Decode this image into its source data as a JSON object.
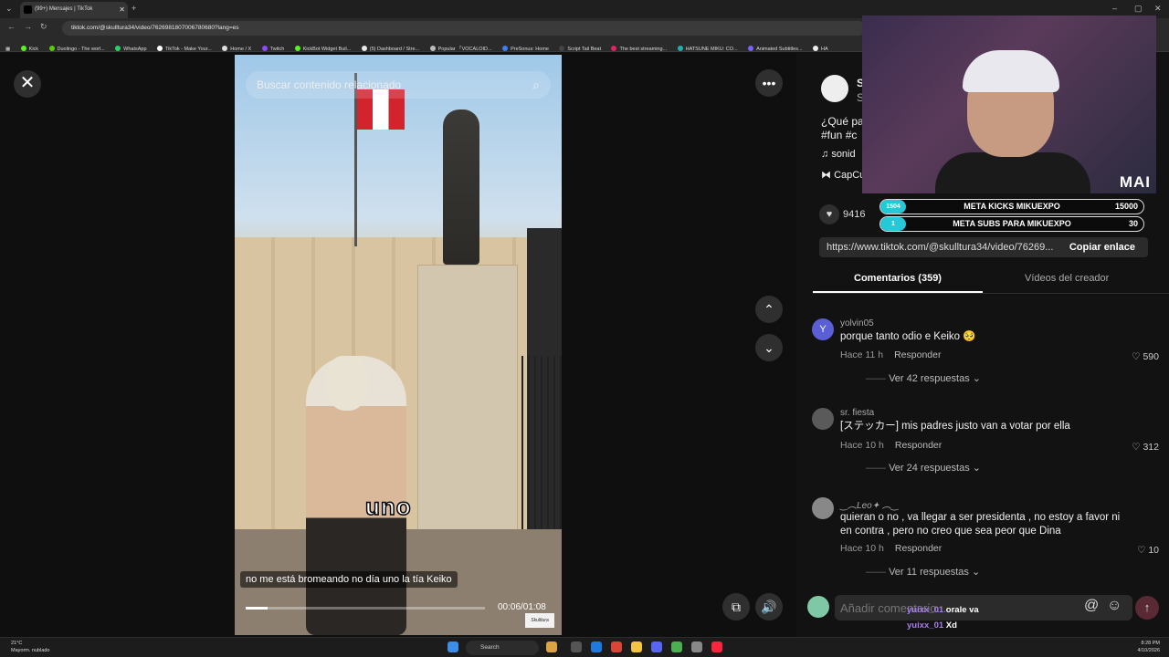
{
  "browser": {
    "tab_title": "(99+) Mensajes | TikTok",
    "url": "tiktok.com/@skulltura34/video/7626981807006780680?lang=es",
    "bookmarks": [
      "Kick",
      "Duolingo - The worl...",
      "WhatsApp",
      "TikTok - Make Your...",
      "Home / X",
      "Twitch",
      "KickBot Widget Buil...",
      "(5) Dashboard / Stre...",
      "Popular 「VOCALOID...",
      "PreSonus: Home",
      "Script Tail Beat",
      "The best streaming...",
      "HATSUNE MIKU: CO...",
      "Animated Subtitles...",
      "HA"
    ]
  },
  "video": {
    "search_placeholder": "Buscar contenido relacionado",
    "caption_word": "uno",
    "subtitle": "no me está bromeando no día uno la tía Keiko",
    "time": "00:06/01:08",
    "progress_fraction": 0.09,
    "watermark": "Skulltura"
  },
  "post": {
    "author_initial": "S",
    "author_line2": "S",
    "description_line1": "¿Qué pa",
    "description_line2": "#fun #c",
    "sound": "sonid",
    "capcut": "CapCu",
    "likes": "9416",
    "link": "https://www.tiktok.com/@skulltura34/video/76269...",
    "copy_label": "Copiar enlace"
  },
  "stream_overlay": {
    "streamer_tag": "MAI",
    "bar1_left": "1504",
    "bar1_label": "META KICKS MIKUEXPO",
    "bar1_right": "15000",
    "bar2_left": "1",
    "bar2_label": "META SUBS PARA MIKUEXPO",
    "bar2_right": "30"
  },
  "tabs": {
    "comments": "Comentarios (359)",
    "creator_videos": "Vídeos del creador"
  },
  "comments": [
    {
      "avatar": "Y",
      "user": "yolvin05",
      "text": "porque tanto odio e Keiko 🥺",
      "time": "Hace 11 h",
      "reply": "Responder",
      "likes": "590",
      "more": "Ver 42 respuestas"
    },
    {
      "avatar": "",
      "user": "sr. fiesta",
      "text": "[ステッカー] mis padres justo van a votar por ella",
      "time": "Hace 10 h",
      "reply": "Responder",
      "likes": "312",
      "more": "Ver 24 respuestas"
    },
    {
      "avatar": "",
      "user": "‿︵Leo✦ ︵‿",
      "text": "quieran o no , va llegar a ser presidenta , no estoy a favor ni en contra , pero no creo que sea peor que Dina",
      "time": "Hace 10 h",
      "reply": "Responder",
      "likes": "10",
      "more": "Ver 11 respuestas"
    }
  ],
  "comment_box": {
    "placeholder": "Añadir comentario..."
  },
  "chat": [
    {
      "user": "yuixx_01",
      "msg": "orale va"
    },
    {
      "user": "yuixx_01",
      "msg": "Xd"
    }
  ],
  "taskbar": {
    "temp": "21°C",
    "weather": "Mayorm. nublado",
    "search": "Search",
    "time": "8:28 PM",
    "date": "4/10/2026"
  },
  "colors": {
    "accent": "#fe2c55",
    "chat_user": "#a97cf0",
    "overlay_teal": "#26c7d7"
  }
}
